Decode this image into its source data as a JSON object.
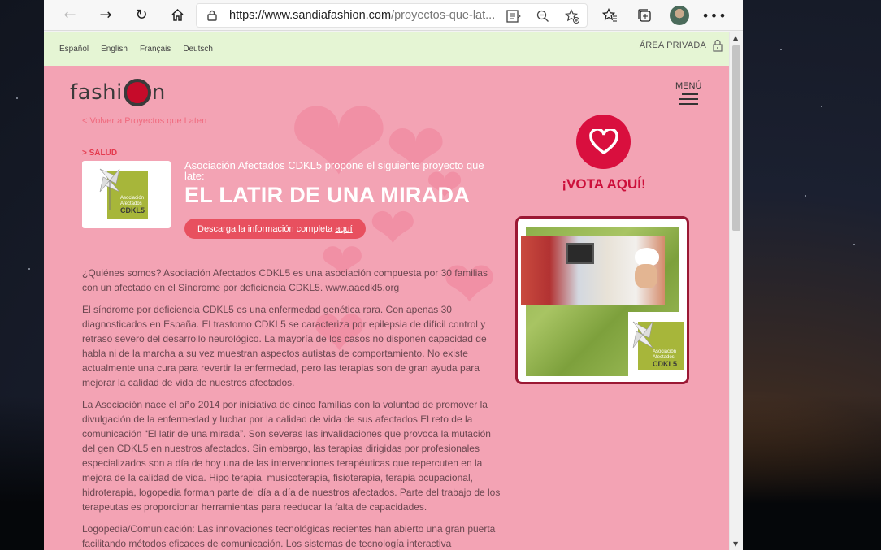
{
  "browser": {
    "url_host": "https://www.sandiafashion.com",
    "url_path": "/proyectos-que-lat...",
    "icons": {
      "back": "back-arrow-icon",
      "forward": "forward-arrow-icon",
      "refresh": "refresh-icon",
      "home": "home-icon",
      "lock": "lock-icon",
      "reader": "reader-mode-icon",
      "zoom": "zoom-out-icon",
      "add_favorite": "add-favorite-icon",
      "favorites": "favorites-icon",
      "collections": "collections-icon",
      "profile": "profile-avatar",
      "more": "more-icon"
    }
  },
  "header": {
    "languages": [
      "Español",
      "English",
      "Français",
      "Deutsch"
    ],
    "private_area": "ÁREA PRIVADA",
    "logo_left": "fashi",
    "logo_right": "n",
    "menu_label": "MENÚ"
  },
  "project": {
    "back_link": "< Volver a Proyectos que Laten",
    "category": "> SALUD",
    "org_logo_lines": [
      "Asociación",
      "Afectados",
      "CDKL5"
    ],
    "intro": "Asociación Afectados CDKL5 propone el siguiente proyecto que late:",
    "title": "EL LATIR DE UNA MIRADA",
    "download_prefix": "Descarga la información completa",
    "download_link": "aquí"
  },
  "vote": {
    "label": "¡VOTA AQUÍ!",
    "accent": "#d90f3e"
  },
  "article": {
    "paragraphs": [
      "¿Quiénes somos? Asociación Afectados CDKL5 es una asociación compuesta por 30 familias con un afectado en el Síndrome por deficiencia CDKL5. www.aacdkl5.org",
      "El síndrome por deficiencia CDKL5 es una enfermedad genética rara. Con apenas 30 diagnosticados en España. El trastorno CDKL5 se caracteriza por epilepsia de difícil control y retraso severo del desarrollo neurológico. La mayoría de los casos no disponen capacidad de habla ni de la marcha a su vez muestran aspectos autistas de comportamiento. No existe actualmente una cura para revertir la enfermedad, pero las terapias son de gran ayuda para mejorar la calidad de vida de nuestros afectados.",
      "La Asociación nace el año 2014 por iniciativa de cinco familias con la voluntad de promover la divulgación de la enfermedad y luchar por la calidad de vida de sus afectados El reto de la comunicación “El latir de una mirada”. Son severas las invalidaciones que provoca la mutación del gen CDKL5 en nuestros afectados. Sin embargo, las terapias dirigidas por profesionales especializados son a día de hoy una de las intervenciones terapéuticas que repercuten en la mejora de la calidad de vida. Hipo terapia, musicoterapia, fisioterapia, terapia ocupacional, hidroterapia, logopedia forman parte del día a día de nuestros afectados. Parte del trabajo de los terapeutas es proporcionar herramientas para reeducar la falta de capacidades.",
      "Logopedia/Comunicación: Las innovaciones tecnológicas recientes han abierto una gran puerta facilitando métodos eficaces de comunicación. Los sistemas de tecnología interactiva"
    ]
  },
  "colors": {
    "page_bg": "#f3a3b4",
    "lang_bar": "#e5f5d4",
    "title_white": "#ffffff",
    "cta": "#e8505f"
  }
}
